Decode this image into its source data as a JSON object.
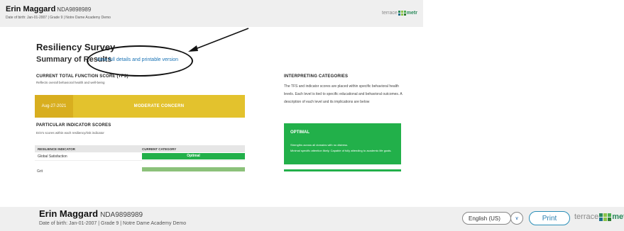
{
  "student": {
    "name": "Erin Maggard",
    "id": "NDA9898989",
    "details_small": "Date of birth: Jan-01-2007 | Grade 9 | Notre Dame Academy Demo",
    "details": "Date of birth: Jan-01-2007 | Grade 9 | Notre Dame Academy Demo"
  },
  "logo": {
    "word": "terrace",
    "suffix": "metr",
    "suffix_bottom": "metric",
    "colors": [
      "#2a8a5a",
      "#8bc34a",
      "#4caf50",
      "#1f6e8c",
      "#8bc34a",
      "#2e7d32"
    ]
  },
  "survey": {
    "title": "Resiliency Survey",
    "summary": "Summary of Results",
    "full_link": "View full details and printable version"
  },
  "tfs": {
    "heading": "CURRENT TOTAL FUNCTION SCORE (TFS)",
    "subtext": "Reflects overall behavioral health and well-being",
    "date": "Aug-27-2021",
    "label": "MODERATE CONCERN",
    "color": "#e3c22d"
  },
  "indicators": {
    "heading": "PARTICULAR INDICATOR SCORES",
    "subtext": "Erin's scores within each resiliency/risk indicator",
    "col1": "RESILIENCE INDICATOR",
    "col2": "CURRENT CATEGORY",
    "rows": [
      {
        "indicator": "Global Satisfaction",
        "category": "Optimal"
      }
    ],
    "cut_text": "Grit"
  },
  "interpreting": {
    "heading": "INTERPRETING CATEGORIES",
    "text": "The TFS and indicator scores are placed within specific behavioral health levels. Each level is tied to specific educational and behavioral outcomes. A description of each level and its implications are below",
    "optimal_title": "OPTIMAL",
    "optimal_l1": "Strengths across all domains with no distress.",
    "optimal_l2": "Minimal specific attention likely. Capable of fully attending to academic life goals.",
    "optimal_color": "#22b04a"
  },
  "controls": {
    "language": "English (US)",
    "print": "Print"
  }
}
